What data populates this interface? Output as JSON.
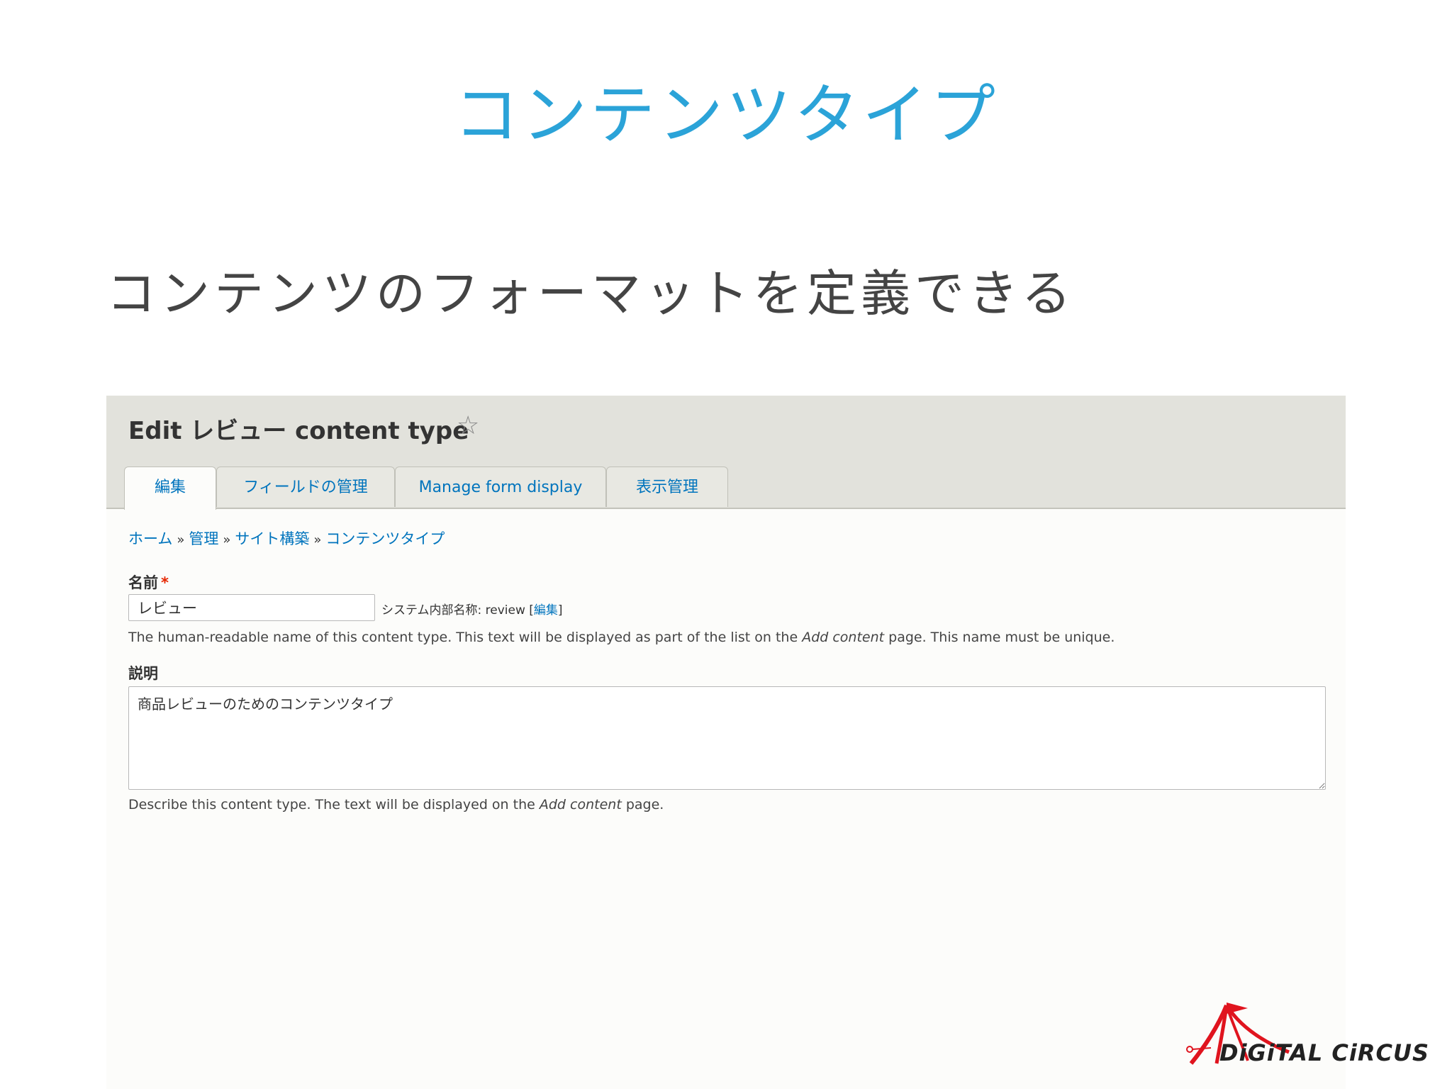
{
  "slide": {
    "title": "コンテンツタイプ",
    "subtitle": "コンテンツのフォーマットを定義できる"
  },
  "screenshot": {
    "page_title": "Edit レビュー content type",
    "tabs": [
      {
        "label": "編集",
        "active": true
      },
      {
        "label": "フィールドの管理",
        "active": false
      },
      {
        "label": "Manage form display",
        "active": false
      },
      {
        "label": "表示管理",
        "active": false
      }
    ],
    "breadcrumb": [
      "ホーム",
      "管理",
      "サイト構築",
      "コンテンツタイプ"
    ],
    "breadcrumb_separator": "»",
    "name_field": {
      "label": "名前",
      "required_mark": "*",
      "value": "レビュー",
      "machine_name_prefix": "システム内部名称: review [",
      "machine_name_edit": "編集",
      "machine_name_suffix": "]",
      "help_before": "The human-readable name of this content type. This text will be displayed as part of the list on the ",
      "help_italic": "Add content",
      "help_after": " page. This name must be unique."
    },
    "description_field": {
      "label": "説明",
      "value": "商品レビューのためのコンテンツタイプ",
      "help_before": "Describe this content type. The text will be displayed on the ",
      "help_italic": "Add content",
      "help_after": " page."
    }
  },
  "logo": {
    "text": "DiGiTAL CiRCUS",
    "colors": {
      "red": "#e0141e",
      "text": "#222222"
    }
  },
  "colors": {
    "title_blue": "#2ba3d8",
    "link_blue": "#0074bd",
    "header_bg": "#e2e2dc"
  }
}
